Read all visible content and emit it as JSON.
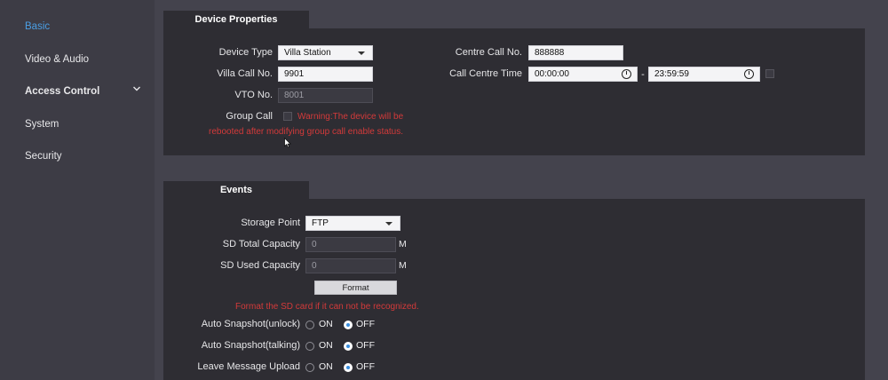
{
  "sidebar": {
    "items": [
      {
        "label": "Basic"
      },
      {
        "label": "Video & Audio"
      },
      {
        "label": "Access Control"
      },
      {
        "label": "System"
      },
      {
        "label": "Security"
      }
    ]
  },
  "device": {
    "tab": "Device Properties",
    "device_type_label": "Device Type",
    "device_type_value": "Villa Station",
    "villa_call_label": "Villa Call No.",
    "villa_call_value": "9901",
    "vto_label": "VTO No.",
    "vto_value": "8001",
    "group_call_label": "Group Call",
    "group_call_warning_1": "Warning:The device will be",
    "group_call_warning_2": "rebooted after modifying group call enable status.",
    "centre_call_label": "Centre Call No.",
    "centre_call_value": "888888",
    "call_centre_time_label": "Call Centre Time",
    "time_start": "00:00:00",
    "time_sep": "-",
    "time_end": "23:59:59"
  },
  "events": {
    "tab": "Events",
    "storage_label": "Storage Point",
    "storage_value": "FTP",
    "sd_total_label": "SD Total Capacity",
    "sd_total_value": "0",
    "sd_used_label": "SD Used Capacity",
    "sd_used_value": "0",
    "unit": "M",
    "format_button": "Format",
    "format_warning": "Format the SD card if it can not be recognized.",
    "on_label": "ON",
    "off_label": "OFF",
    "rows": [
      {
        "label": "Auto Snapshot(unlock)",
        "selected": "OFF"
      },
      {
        "label": "Auto Snapshot(talking)",
        "selected": "OFF"
      },
      {
        "label": "Leave Message Upload",
        "selected": "OFF"
      }
    ]
  },
  "colors": {
    "accent": "#4a9ee3",
    "warning": "#d33a3a"
  }
}
